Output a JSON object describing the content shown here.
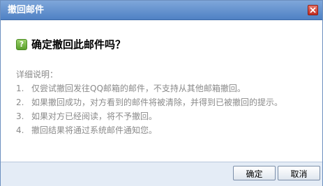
{
  "dialog": {
    "title": "撤回邮件",
    "close_icon": "close-icon"
  },
  "question": {
    "icon": "question-icon",
    "icon_glyph": "?",
    "text": "确定撤回此邮件吗？"
  },
  "details": {
    "header": "详细说明：",
    "items": [
      {
        "num": "1.",
        "text": "仅尝试撤回发往QQ邮箱的邮件，不支持从其他邮箱撤回。"
      },
      {
        "num": "2.",
        "text": "如果撤回成功，对方看到的邮件将被清除，并得到已被撤回的提示。"
      },
      {
        "num": "3.",
        "text": "如果对方已经阅读，将不予撤回。"
      },
      {
        "num": "4.",
        "text": "撤回结果将通过系统邮件通知您。"
      }
    ]
  },
  "buttons": {
    "ok_label": "确定",
    "cancel_label": "取消"
  },
  "colors": {
    "titlebar": "#4f81c4",
    "footer": "#e4ecf6",
    "detail_text": "#8a8a8a",
    "close_button": "#c22e22",
    "question_icon": "#5aa02c"
  }
}
